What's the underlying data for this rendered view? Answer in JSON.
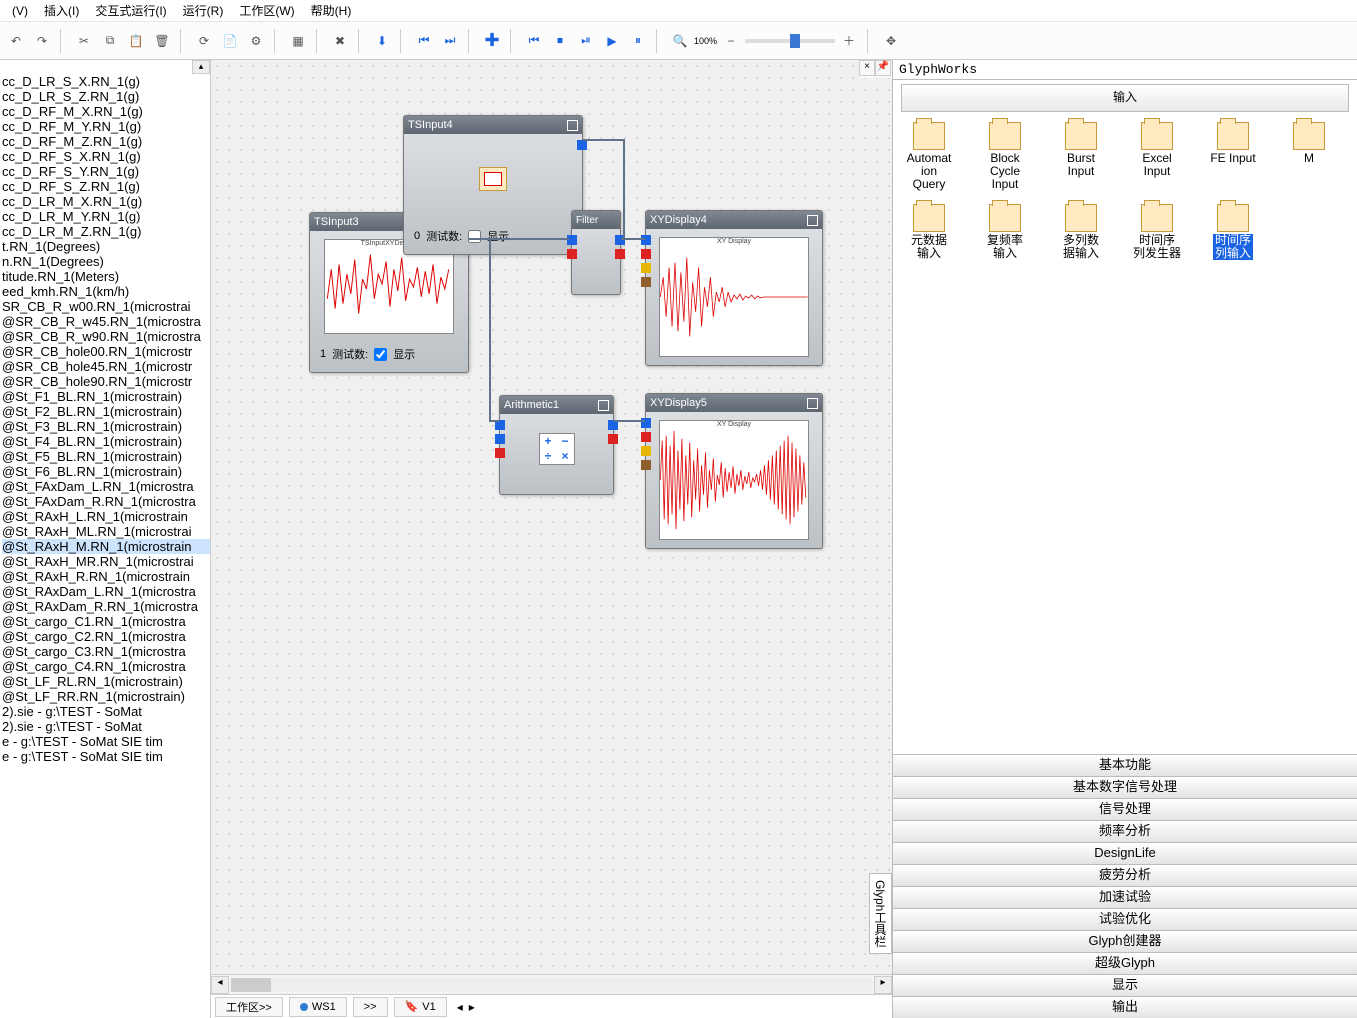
{
  "menu": {
    "v": "(V)",
    "insert": "插入(I)",
    "interactive": "交互式运行(I)",
    "run": "运行(R)",
    "workspace": "工作区(W)",
    "help": "帮助(H)"
  },
  "zoom_pct": "100%",
  "channels": [
    "cc_D_LR_S_X.RN_1(g)",
    "cc_D_LR_S_Z.RN_1(g)",
    "cc_D_RF_M_X.RN_1(g)",
    "cc_D_RF_M_Y.RN_1(g)",
    "cc_D_RF_M_Z.RN_1(g)",
    "cc_D_RF_S_X.RN_1(g)",
    "cc_D_RF_S_Y.RN_1(g)",
    "cc_D_RF_S_Z.RN_1(g)",
    "cc_D_LR_M_X.RN_1(g)",
    "cc_D_LR_M_Y.RN_1(g)",
    "cc_D_LR_M_Z.RN_1(g)",
    "t.RN_1(Degrees)",
    "n.RN_1(Degrees)",
    "titude.RN_1(Meters)",
    "eed_kmh.RN_1(km/h)",
    "SR_CB_R_w00.RN_1(microstrai",
    "@SR_CB_R_w45.RN_1(microstra",
    "@SR_CB_R_w90.RN_1(microstra",
    "@SR_CB_hole00.RN_1(microstr",
    "@SR_CB_hole45.RN_1(microstr",
    "@SR_CB_hole90.RN_1(microstr",
    "@St_F1_BL.RN_1(microstrain)",
    "@St_F2_BL.RN_1(microstrain)",
    "@St_F3_BL.RN_1(microstrain)",
    "@St_F4_BL.RN_1(microstrain)",
    "@St_F5_BL.RN_1(microstrain)",
    "@St_F6_BL.RN_1(microstrain)",
    "@St_FAxDam_L.RN_1(microstra",
    "@St_FAxDam_R.RN_1(microstra",
    "@St_RAxH_L.RN_1(microstrain",
    "@St_RAxH_ML.RN_1(microstrai",
    "@St_RAxH_M.RN_1(microstrain",
    "@St_RAxH_MR.RN_1(microstrai",
    "@St_RAxH_R.RN_1(microstrain",
    "@St_RAxDam_L.RN_1(microstra",
    "@St_RAxDam_R.RN_1(microstra",
    "@St_cargo_C1.RN_1(microstra",
    "@St_cargo_C2.RN_1(microstra",
    "@St_cargo_C3.RN_1(microstra",
    "@St_cargo_C4.RN_1(microstra",
    "@St_LF_RL.RN_1(microstrain)",
    "@St_LF_RR.RN_1(microstrain)",
    "2).sie - g:\\TEST - SoMat",
    "2).sie - g:\\TEST - SoMat",
    "e - g:\\TEST - SoMat SIE tim",
    "e - g:\\TEST - SoMat SIE tim"
  ],
  "channel_selected_index": 31,
  "nodes": {
    "tsinput3": {
      "title": "TSInput3",
      "footer_num": "1",
      "footer_label": "测试数:",
      "footer_show": "显示",
      "chart_title": "TSInputXYDisplay"
    },
    "tsinput4": {
      "title": "TSInput4",
      "footer_num": "0",
      "footer_label": "测试数:",
      "footer_show": "显示"
    },
    "filter": {
      "title": "Filter"
    },
    "arithmetic": {
      "title": "Arithmetic1",
      "ops": "+ −\n÷ ×"
    },
    "xy4": {
      "title": "XYDisplay4",
      "chart_title": "XY Display"
    },
    "xy5": {
      "title": "XYDisplay5",
      "chart_title": "XY Display"
    }
  },
  "tabs": {
    "ws_label": "工作区>>",
    "ws1": "WS1",
    "vs": ">>",
    "v1": "V1"
  },
  "right": {
    "header": "GlyphWorks",
    "input_tab": "输入",
    "icons": [
      {
        "label": "Automat\nion\nQuery"
      },
      {
        "label": "Block\nCycle\nInput"
      },
      {
        "label": "Burst\nInput"
      },
      {
        "label": "Excel\nInput"
      },
      {
        "label": "FE Input"
      },
      {
        "label": "M"
      },
      {
        "label": "元数据\n输入"
      },
      {
        "label": "复频率\n输入"
      },
      {
        "label": "多列数\n据输入"
      },
      {
        "label": "时间序\n列发生器"
      },
      {
        "label": "时间序\n列输入",
        "selected": true
      }
    ],
    "cats": [
      "基本功能",
      "基本数字信号处理",
      "信号处理",
      "频率分析",
      "DesignLife",
      "疲劳分析",
      "加速试验",
      "试验优化",
      "Glyph创建器",
      "超级Glyph",
      "显示",
      "输出"
    ],
    "sidetab": "Glyph工具栏"
  }
}
